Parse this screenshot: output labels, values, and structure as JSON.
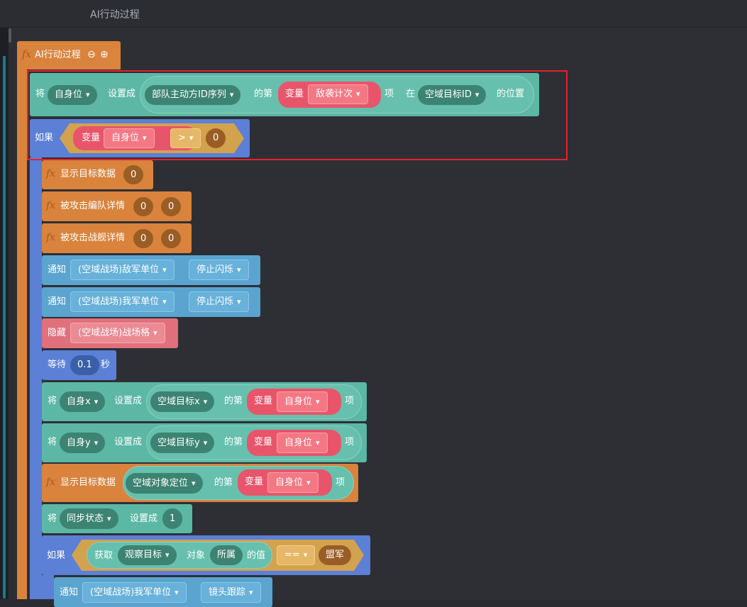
{
  "header": {
    "title": "AI行动过程"
  },
  "fx": "fx",
  "function_block": {
    "name": "AI行动过程",
    "minus": "⊖",
    "plus": "⊕"
  },
  "row1": {
    "kw_set": "将",
    "var": "自身位",
    "kw_setto": "设置成",
    "list": "部队主动方ID序列",
    "kw_index": "的第",
    "kw_var": "变量",
    "var2": "敌袭计次",
    "kw_item": "项",
    "kw_in": "在",
    "list2": "空域目标ID",
    "kw_pos": "的位置"
  },
  "row2": {
    "kw_if": "如果",
    "kw_var": "变量",
    "var": "自身位",
    "op": ">",
    "value": "0"
  },
  "rows": {
    "r3": {
      "label": "显示目标数据",
      "v1": "0"
    },
    "r4": {
      "label": "被攻击编队详情",
      "v1": "0",
      "v2": "0"
    },
    "r5": {
      "label": "被攻击战舰详情",
      "v1": "0",
      "v2": "0"
    },
    "r6": {
      "kw": "通知",
      "target": "(空域战场)敌军单位",
      "action": "停止闪烁"
    },
    "r7": {
      "kw": "通知",
      "target": "(空域战场)我军单位",
      "action": "停止闪烁"
    },
    "r8": {
      "kw": "隐藏",
      "target": "(空域战场)战场格"
    },
    "r9": {
      "kw": "等待",
      "value": "0.1",
      "unit": "秒"
    },
    "r10": {
      "kw_set": "将",
      "var": "自身x",
      "kw_setto": "设置成",
      "list": "空域目标x",
      "kw_index": "的第",
      "kw_var": "变量",
      "var2": "自身位",
      "kw_item": "项"
    },
    "r11": {
      "kw_set": "将",
      "var": "自身y",
      "kw_setto": "设置成",
      "list": "空域目标y",
      "kw_index": "的第",
      "kw_var": "变量",
      "var2": "自身位",
      "kw_item": "项"
    },
    "r12": {
      "label": "显示目标数据",
      "list": "空域对象定位",
      "kw_index": "的第",
      "kw_var": "变量",
      "var2": "自身位",
      "kw_item": "项"
    },
    "r13": {
      "kw_set": "将",
      "var": "同步状态",
      "kw_setto": "设置成",
      "value": "1"
    },
    "r14": {
      "kw_if": "如果",
      "kw_get": "获取",
      "target": "观察目标",
      "kw_obj": "对象",
      "prop": "所属",
      "kw_val": "的值",
      "op": "==",
      "value": "盟军"
    },
    "r15": {
      "kw": "通知",
      "target": "(空域战场)我军单位",
      "action": "镜头跟踪"
    }
  },
  "colors": {
    "event_orange": "#d9833c",
    "data_teal": "#5cb7a4",
    "control_blue": "#5b80d6",
    "notify_sky": "#5ba4cf",
    "hide_pink": "#e0707b",
    "variable_red": "#e8556b",
    "number_brown": "#9a5d25",
    "operator_gold": "#d3a24f",
    "selection_red": "#e8202b",
    "background": "#2d2f35"
  },
  "icons": {
    "dropdown": "triangle-down-icon",
    "collapse": "minus-circle-icon",
    "expand": "plus-circle-icon",
    "function": "fx-icon"
  }
}
